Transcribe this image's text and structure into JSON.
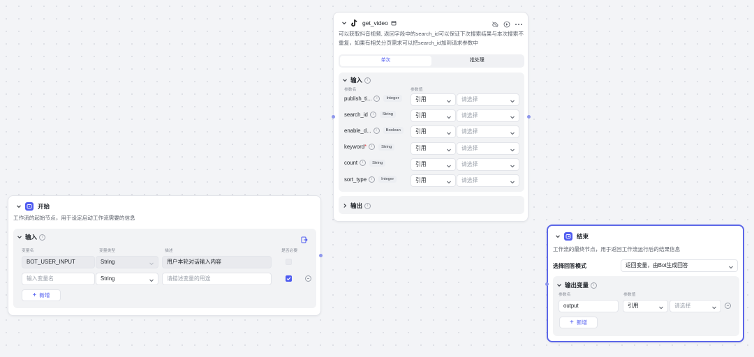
{
  "start_node": {
    "title": "开始",
    "description": "工作流的起始节点，用于设定启动工作流需要的信息",
    "input_section": {
      "title": "输入",
      "columns": [
        "变量名",
        "变量类型",
        "描述",
        "是否必要"
      ],
      "rows": [
        {
          "name": "BOT_USER_INPUT",
          "type": "String",
          "description": "用户本轮对话输入内容",
          "required": false
        },
        {
          "name_placeholder": "输入变量名",
          "type": "String",
          "description_placeholder": "请描述变量的用途",
          "required": true
        }
      ],
      "add_label": "新增"
    }
  },
  "video_node": {
    "title": "get_video",
    "description": "可以获取抖音视频, 返回字段中的search_id可以保证下次搜索结果与本次搜索不重复，如果有相关分页需求可以把search_id加到请求参数中",
    "tabs": [
      "单次",
      "批处理"
    ],
    "active_tab": "单次",
    "input_section": {
      "title": "输入",
      "columns": [
        "参数名",
        "参数值"
      ],
      "params": [
        {
          "name": "publish_ti...",
          "type": "Integer",
          "required": false,
          "mode": "引用",
          "placeholder": "请选择"
        },
        {
          "name": "search_id",
          "type": "String",
          "required": false,
          "mode": "引用",
          "placeholder": "请选择"
        },
        {
          "name": "enable_d...",
          "type": "Boolean",
          "required": false,
          "mode": "引用",
          "placeholder": "请选择"
        },
        {
          "name": "keyword",
          "type": "String",
          "required": true,
          "mode": "引用",
          "placeholder": "请选择"
        },
        {
          "name": "count",
          "type": "String",
          "required": false,
          "mode": "引用",
          "placeholder": "请选择"
        },
        {
          "name": "sort_type",
          "type": "Integer",
          "required": false,
          "mode": "引用",
          "placeholder": "请选择"
        }
      ]
    },
    "output_section": {
      "title": "输出"
    }
  },
  "end_node": {
    "title": "结束",
    "description": "工作流的最终节点，用于返回工作流运行后的结果信息",
    "answer_mode_label": "选择回答模式",
    "answer_mode_value": "返回变量，由Bot生成回答",
    "output_section": {
      "title": "输出变量",
      "columns": [
        "参数名",
        "参数值"
      ],
      "rows": [
        {
          "name": "output",
          "mode": "引用",
          "placeholder": "请选择"
        }
      ],
      "add_label": "新增"
    }
  },
  "colors": {
    "accent": "#4e5bf0",
    "selected_border": "#5b66e8",
    "canvas": "#f3f4f7",
    "required_star": "#e5484d"
  }
}
